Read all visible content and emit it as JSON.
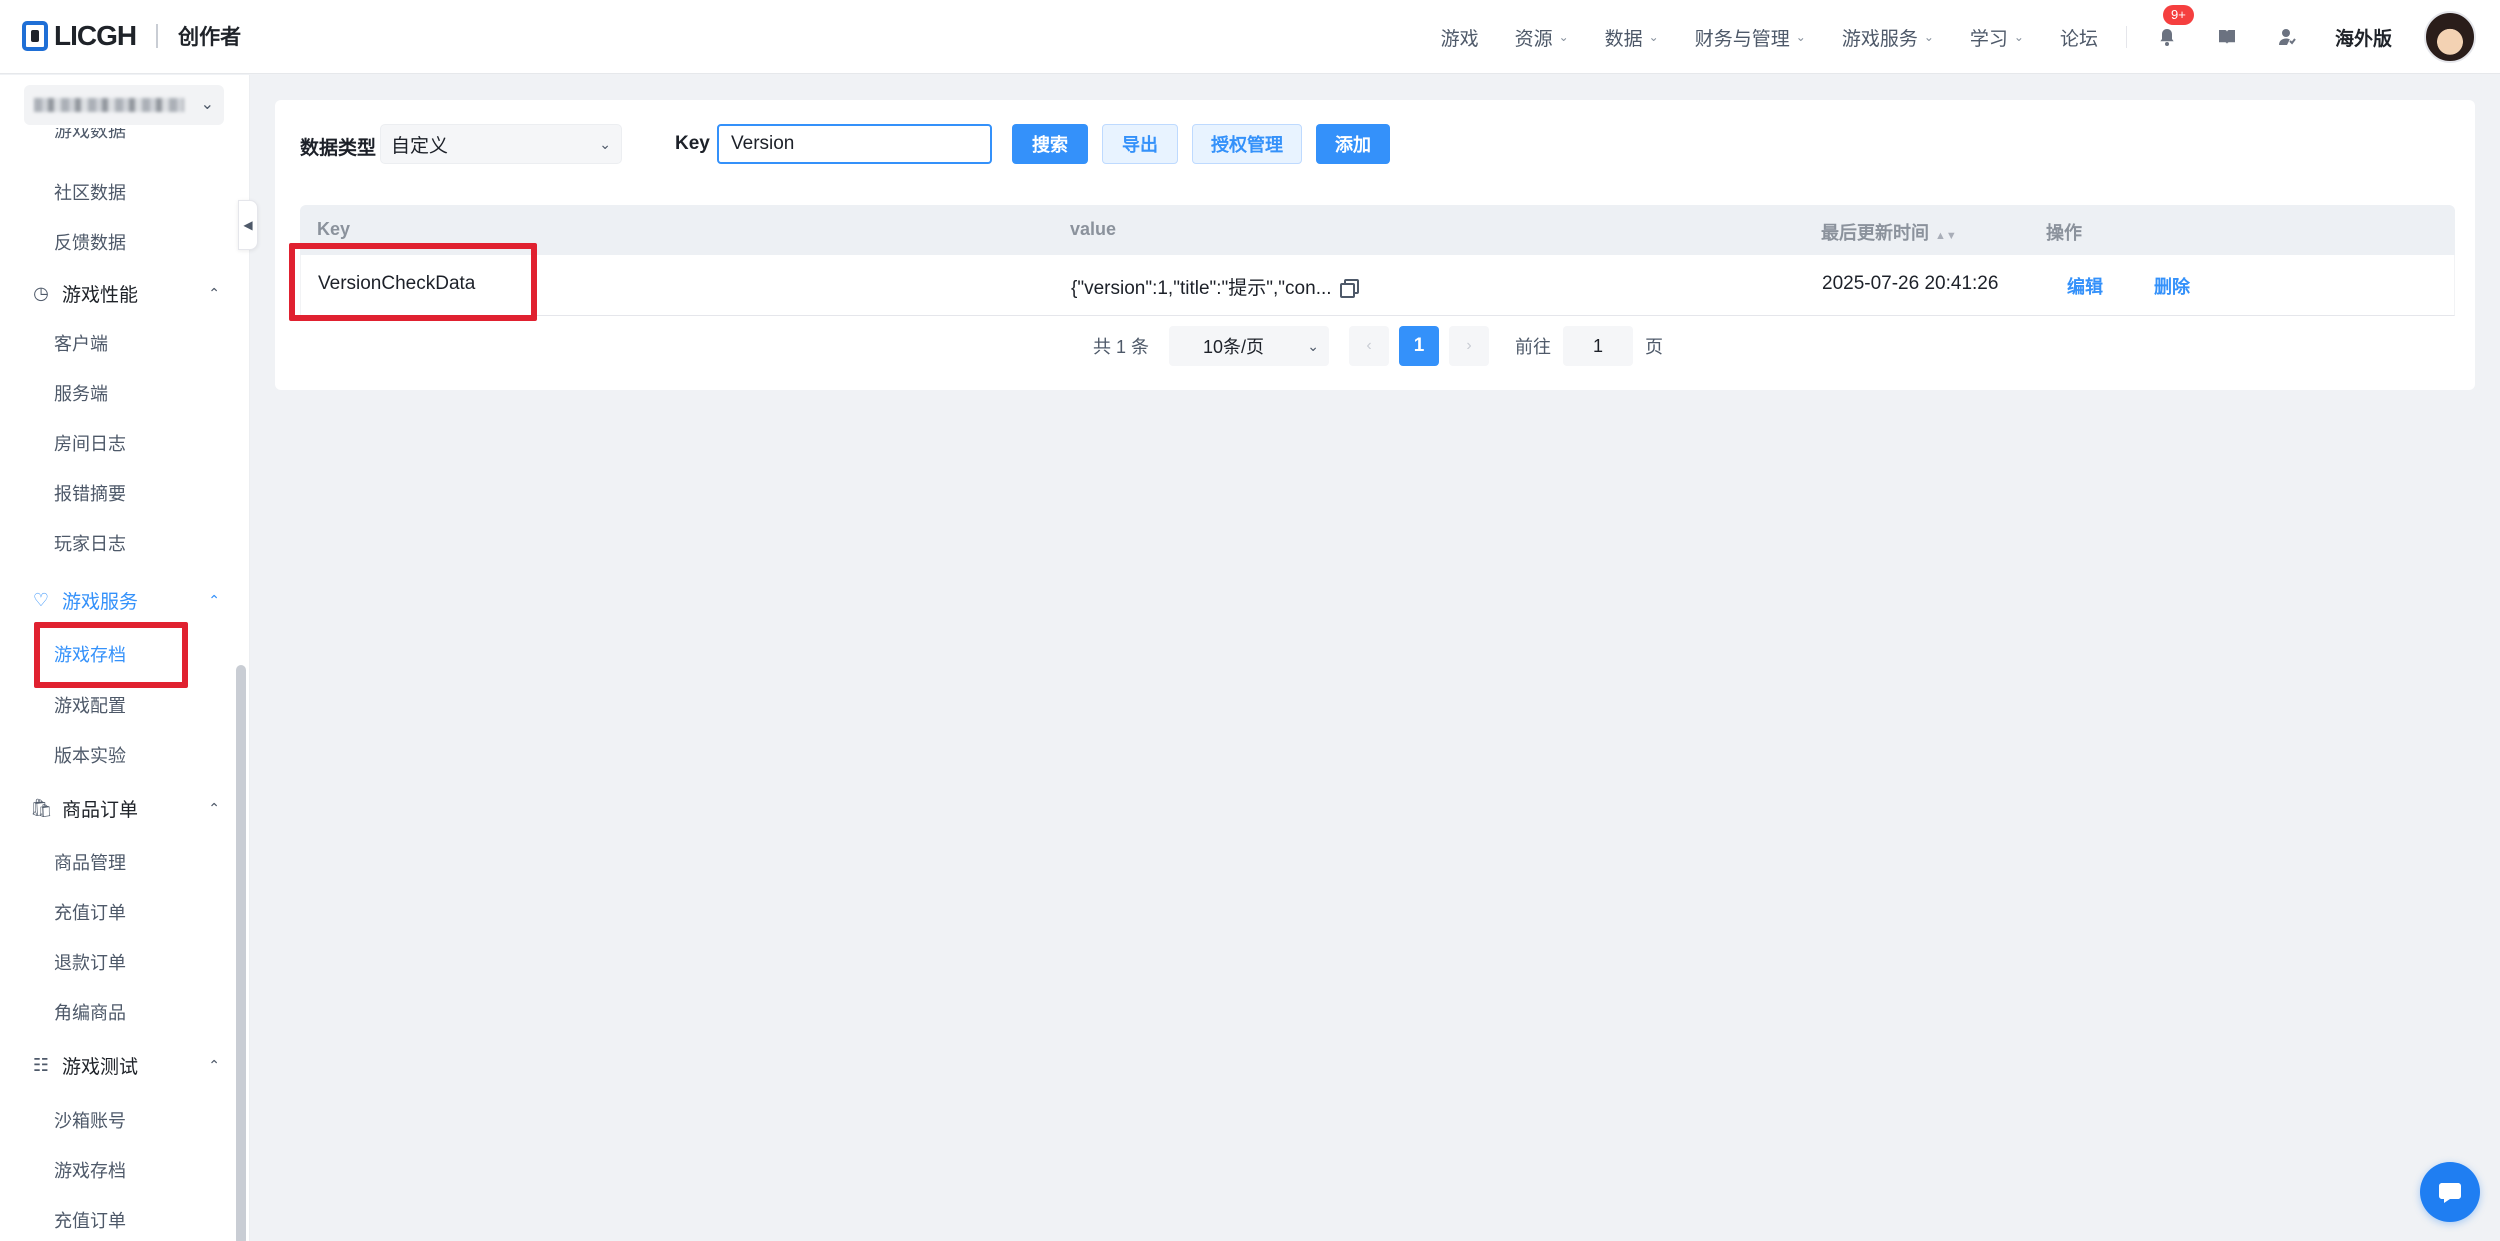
{
  "header": {
    "logo_text": "LICGH",
    "logo_sub": "创作者",
    "nav": [
      {
        "label": "游戏",
        "has_menu": false
      },
      {
        "label": "资源",
        "has_menu": true
      },
      {
        "label": "数据",
        "has_menu": true
      },
      {
        "label": "财务与管理",
        "has_menu": true
      },
      {
        "label": "游戏服务",
        "has_menu": true
      },
      {
        "label": "学习",
        "has_menu": true
      },
      {
        "label": "论坛",
        "has_menu": false
      }
    ],
    "notification_badge": "9+",
    "overseas_label": "海外版"
  },
  "sidebar": {
    "partial_top_item": "游戏数据",
    "items": [
      {
        "type": "item",
        "label": "社区数据"
      },
      {
        "type": "item",
        "label": "反馈数据"
      },
      {
        "type": "group",
        "label": "游戏性能",
        "icon": "gauge-icon",
        "expanded": true
      },
      {
        "type": "item",
        "label": "客户端"
      },
      {
        "type": "item",
        "label": "服务端"
      },
      {
        "type": "item",
        "label": "房间日志"
      },
      {
        "type": "item",
        "label": "报错摘要"
      },
      {
        "type": "item",
        "label": "玩家日志"
      },
      {
        "type": "group",
        "label": "游戏服务",
        "icon": "heart-icon",
        "expanded": true,
        "active": true
      },
      {
        "type": "item",
        "label": "游戏存档",
        "active": true
      },
      {
        "type": "item",
        "label": "游戏配置"
      },
      {
        "type": "item",
        "label": "版本实验"
      },
      {
        "type": "group",
        "label": "商品订单",
        "icon": "bag-icon",
        "expanded": true
      },
      {
        "type": "item",
        "label": "商品管理"
      },
      {
        "type": "item",
        "label": "充值订单"
      },
      {
        "type": "item",
        "label": "退款订单"
      },
      {
        "type": "item",
        "label": "角编商品"
      },
      {
        "type": "group",
        "label": "游戏测试",
        "icon": "sliders-icon",
        "expanded": true
      },
      {
        "type": "item",
        "label": "沙箱账号"
      },
      {
        "type": "item",
        "label": "游戏存档"
      },
      {
        "type": "item",
        "label": "充值订单"
      }
    ]
  },
  "filters": {
    "data_type_label": "数据类型",
    "data_type_value": "自定义",
    "key_label": "Key",
    "key_value": "Version",
    "buttons": {
      "search": "搜索",
      "export": "导出",
      "auth": "授权管理",
      "add": "添加"
    }
  },
  "table": {
    "columns": [
      "Key",
      "value",
      "最后更新时间",
      "操作"
    ],
    "rows": [
      {
        "key": "VersionCheckData",
        "value": "{\"version\":1,\"title\":\"提示\",\"con...",
        "updated": "2025-07-26 20:41:26",
        "actions": [
          "编辑",
          "删除"
        ]
      }
    ]
  },
  "pagination": {
    "total_text": "共 1 条",
    "page_size": "10条/页",
    "current_page": "1",
    "goto_label": "前往",
    "goto_value": "1",
    "page_suffix": "页"
  },
  "colors": {
    "accent": "#3491fa",
    "highlight_box": "#e02130"
  }
}
